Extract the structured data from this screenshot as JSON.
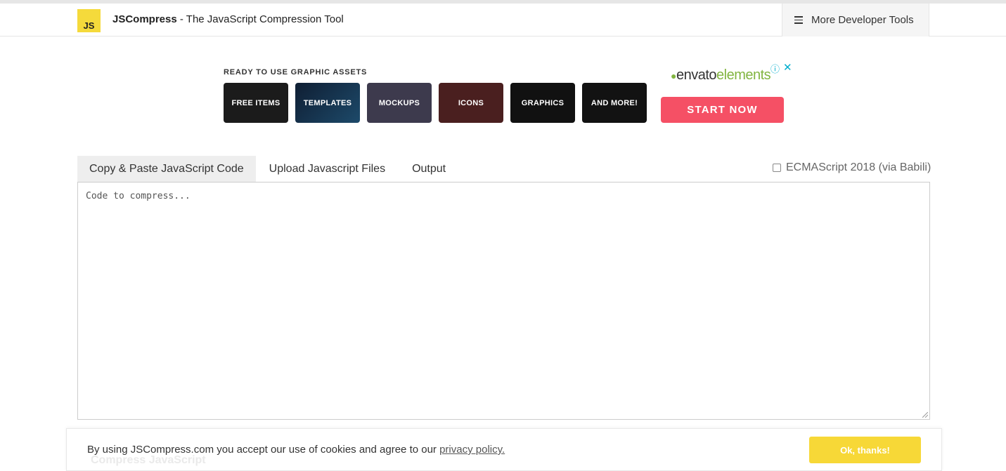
{
  "header": {
    "logo_text": "JS",
    "brand_name": "JSCompress",
    "brand_tagline": " - The JavaScript Compression Tool",
    "more_tools_label": "More Developer Tools"
  },
  "ad": {
    "heading": "READY TO USE GRAPHIC ASSETS",
    "tiles": [
      {
        "label": "FREE ITEMS",
        "bg": "#1b1b1b"
      },
      {
        "label": "TEMPLATES",
        "bg": "#0f1e33"
      },
      {
        "label": "MOCKUPS",
        "bg": "#3d3a4d"
      },
      {
        "label": "ICONS",
        "bg": "#4a1f1f"
      },
      {
        "label": "GRAPHICS",
        "bg": "#111111"
      },
      {
        "label": "AND MORE!",
        "bg": "#121212"
      }
    ],
    "brand_word": "envato",
    "brand_suffix": "elements",
    "info_glyph": "ⓘ",
    "close_glyph": "✕",
    "cta_label": "START NOW"
  },
  "tabs": [
    {
      "label": "Copy & Paste JavaScript Code",
      "active": true
    },
    {
      "label": "Upload Javascript Files",
      "active": false
    },
    {
      "label": "Output",
      "active": false
    }
  ],
  "ecma_label": "ECMAScript 2018 (via Babili)",
  "editor": {
    "placeholder": "Code to compress..."
  },
  "cookie": {
    "text": "By using JSCompress.com you accept our use of cookies and agree to our ",
    "link_text": "privacy policy.",
    "button_label": "Ok, thanks!",
    "hidden_button_label": "Compress JavaScript"
  },
  "colors": {
    "logo_yellow": "#f5da3b",
    "cta_pink": "#f55065",
    "cookie_button": "#f7d837",
    "envato_green": "#82b541"
  }
}
